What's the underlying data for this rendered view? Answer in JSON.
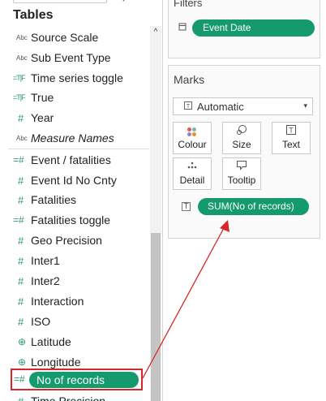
{
  "data_pane": {
    "heading": "Tables",
    "fields_top": [
      {
        "type": "Abc",
        "label": "Source Scale"
      },
      {
        "type": "Abc",
        "label": "Sub Event Type"
      },
      {
        "type": "=T|F",
        "label": "Time series toggle"
      },
      {
        "type": "=T|F",
        "label": "True"
      },
      {
        "type": "#",
        "label": "Year"
      },
      {
        "type": "Abc",
        "label": "Measure Names"
      }
    ],
    "fields_measures": [
      {
        "type": "=#",
        "label": "Event / fatalities"
      },
      {
        "type": "#",
        "label": "Event Id No Cnty"
      },
      {
        "type": "#",
        "label": "Fatalities"
      },
      {
        "type": "=#",
        "label": "Fatalities toggle"
      },
      {
        "type": "#",
        "label": "Geo Precision"
      },
      {
        "type": "#",
        "label": "Inter1"
      },
      {
        "type": "#",
        "label": "Inter2"
      },
      {
        "type": "#",
        "label": "Interaction"
      },
      {
        "type": "#",
        "label": "ISO"
      },
      {
        "type": "⊕",
        "label": "Latitude"
      },
      {
        "type": "⊕",
        "label": "Longitude"
      }
    ],
    "highlighted_field": {
      "type": "=#",
      "label": "No of records"
    },
    "partial_field": {
      "type": "#",
      "label": "Time Precision"
    },
    "scroll_up_glyph": "^"
  },
  "filters": {
    "title": "Filters",
    "icon": "calendar-icon",
    "pill": "Event Date"
  },
  "marks": {
    "title": "Marks",
    "type_icon": "T",
    "type_label": "Automatic",
    "type_arrow": "▾",
    "buttons": [
      {
        "id": "colour",
        "label": "Colour",
        "icon": "colour-dots-icon"
      },
      {
        "id": "size",
        "label": "Size",
        "icon": "size-icon"
      },
      {
        "id": "text",
        "label": "Text",
        "icon": "text-icon"
      },
      {
        "id": "detail",
        "label": "Detail",
        "icon": "detail-icon"
      },
      {
        "id": "tooltip",
        "label": "Tooltip",
        "icon": "tooltip-icon"
      }
    ],
    "measure_icon": "T",
    "measure_pill": "SUM(No of records)"
  },
  "colors": {
    "pill_green": "#159a6e",
    "annotation_red": "#d62828"
  }
}
